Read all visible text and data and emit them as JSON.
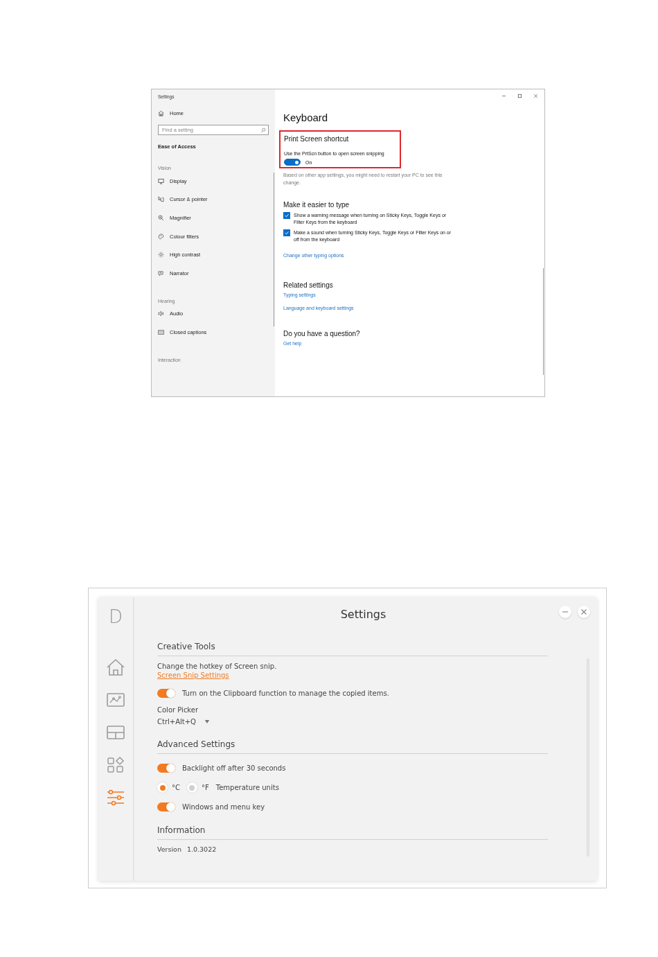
{
  "top_window": {
    "title": "Settings",
    "sidebar": {
      "home": "Home",
      "search": {
        "placeholder": "Find a setting"
      },
      "category": "Ease of Access",
      "groups": [
        {
          "heading": "Vision",
          "items": [
            "Display",
            "Cursor & pointer",
            "Magnifier",
            "Colour filters",
            "High contrast",
            "Narrator"
          ]
        },
        {
          "heading": "Hearing",
          "items": [
            "Audio",
            "Closed captions"
          ]
        },
        {
          "heading": "Interaction"
        }
      ]
    },
    "main": {
      "heading": "Keyboard",
      "highlighted": {
        "title": "Print Screen shortcut",
        "description": "Use the PrtScn button to open screen snipping",
        "toggle": {
          "on": true,
          "label": "On"
        }
      },
      "note": "Based on other app settings, you might need to restart your PC to see this change.",
      "typing": {
        "title": "Make it easier to type",
        "options": [
          {
            "label": "Show a warning message when turning on Sticky Keys, Toggle Keys or Filter Keys from the keyboard",
            "checked": true
          },
          {
            "label": "Make a sound when turning Sticky Keys, Toggle Keys or Filter Keys on or off from the keyboard",
            "checked": true
          }
        ],
        "link": "Change other typing options"
      },
      "related": {
        "title": "Related settings",
        "links": [
          "Typing settings",
          "Language and keyboard settings"
        ]
      },
      "help": {
        "title": "Do you have a question?",
        "link": "Get help"
      }
    }
  },
  "bottom_window": {
    "logo": "D",
    "title": "Settings",
    "nav": [
      {
        "selected": false
      },
      {
        "selected": false
      },
      {
        "selected": false
      },
      {
        "selected": false
      },
      {
        "selected": true
      }
    ],
    "sections": [
      {
        "title": "Creative Tools",
        "rows": [
          {
            "kind": "text",
            "text": "Change the hotkey of Screen snip."
          },
          {
            "kind": "link",
            "text": "Screen Snip Settings"
          },
          {
            "kind": "toggle",
            "label": "Turn on the Clipboard function to manage the copied items.",
            "on": true
          },
          {
            "kind": "text",
            "text": "Color Picker"
          },
          {
            "kind": "dropdown",
            "value": "Ctrl+Alt+Q"
          }
        ]
      },
      {
        "title": "Advanced Settings",
        "rows": [
          {
            "kind": "toggle",
            "label": "Backlight off after 30 seconds",
            "on": true
          },
          {
            "kind": "radio",
            "options": [
              {
                "label": "°C",
                "selected": true
              },
              {
                "label": "°F",
                "selected": false
              }
            ],
            "label": "Temperature units"
          },
          {
            "kind": "toggle",
            "label": "Windows and menu key",
            "on": true
          }
        ]
      },
      {
        "title": "Information",
        "rows": [
          {
            "kind": "info",
            "label": "Version",
            "value": "1.0.3022"
          }
        ]
      }
    ]
  }
}
